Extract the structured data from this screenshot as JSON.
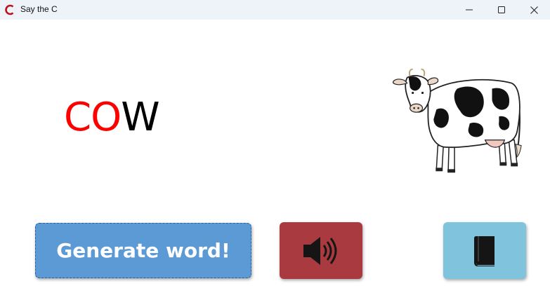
{
  "window": {
    "title": "Say the C",
    "app_icon": "red-c-icon",
    "controls": [
      "minimize-icon",
      "maximize-icon",
      "close-icon"
    ]
  },
  "main": {
    "word_highlight": "CO",
    "word_rest": "W",
    "colors": {
      "highlight": "#ff0000",
      "rest": "#000000"
    },
    "picture": "cow"
  },
  "buttons": {
    "generate_label": "Generate word!",
    "generate_color": "#5b9ad5",
    "sound_icon": "speaker-icon",
    "sound_color": "#a93b40",
    "book_icon": "book-icon",
    "book_color": "#7fc3dc"
  }
}
